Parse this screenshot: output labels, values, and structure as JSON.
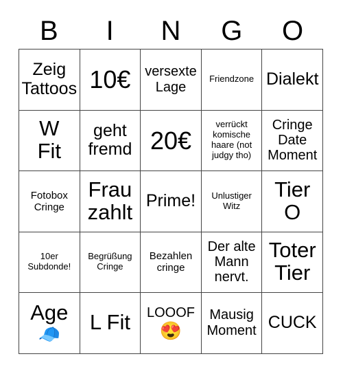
{
  "card": {
    "header_letters": [
      "B",
      "I",
      "N",
      "G",
      "O"
    ],
    "rows": [
      [
        {
          "text": "Zeig\nTattoos",
          "size": "sz-l"
        },
        {
          "text": "10€",
          "size": "sz-xxl"
        },
        {
          "text": "versexte\nLage",
          "size": "sz-m"
        },
        {
          "text": "Friendzone",
          "size": "sz-xs"
        },
        {
          "text": "Dialekt",
          "size": "sz-l"
        }
      ],
      [
        {
          "text": "W\nFit",
          "size": "sz-xl"
        },
        {
          "text": "geht\nfremd",
          "size": "sz-l"
        },
        {
          "text": "20€",
          "size": "sz-xxl"
        },
        {
          "text": "verrückt\nkomische\nhaare (not\njudgy tho)",
          "size": "sz-xs"
        },
        {
          "text": "Cringe\nDate\nMoment",
          "size": "sz-m"
        }
      ],
      [
        {
          "text": "Fotobox\nCringe",
          "size": "sz-s"
        },
        {
          "text": "Frau\nzahlt",
          "size": "sz-xl"
        },
        {
          "text": "Prime!",
          "size": "sz-l"
        },
        {
          "text": "Unlustiger\nWitz",
          "size": "sz-xs"
        },
        {
          "text": "Tier\nO",
          "size": "sz-xl"
        }
      ],
      [
        {
          "text": "10er\nSubdonde!",
          "size": "sz-xs"
        },
        {
          "text": "Begrüßung\nCringe",
          "size": "sz-xs"
        },
        {
          "text": "Bezahlen\ncringe",
          "size": "sz-s"
        },
        {
          "text": "Der alte\nMann\nnervt.",
          "size": "sz-m"
        },
        {
          "text": "Toter\nTier",
          "size": "sz-xl"
        }
      ],
      [
        {
          "text": "Age",
          "size": "sz-xl",
          "emoji": "🧢"
        },
        {
          "text": "L Fit",
          "size": "sz-xl"
        },
        {
          "text": "LOOOF",
          "size": "sz-m",
          "emoji": "😍"
        },
        {
          "text": "Mausig\nMoment",
          "size": "sz-m"
        },
        {
          "text": "CUCK",
          "size": "sz-l"
        }
      ]
    ]
  },
  "colors": {
    "grid_line": "#444444",
    "background": "#ffffff",
    "text": "#000000"
  }
}
